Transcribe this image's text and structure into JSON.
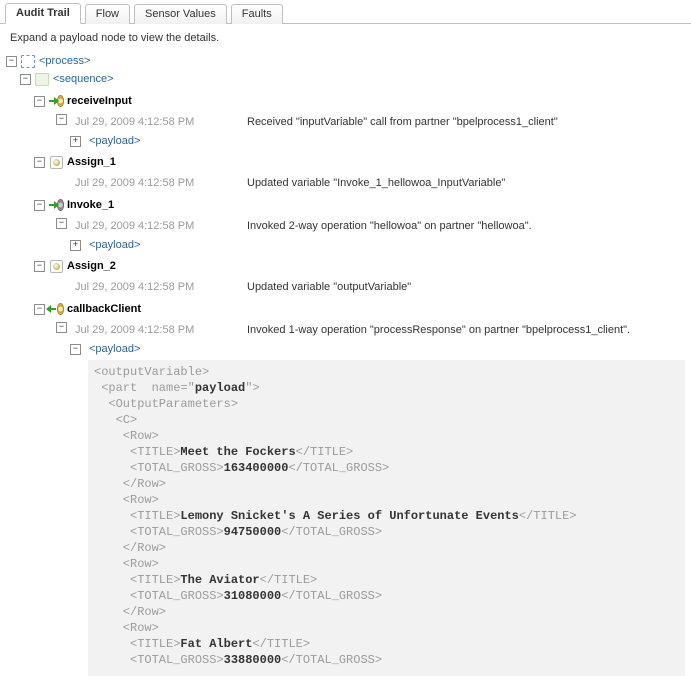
{
  "tabs": {
    "audit": "Audit Trail",
    "flow": "Flow",
    "sensor": "Sensor Values",
    "faults": "Faults"
  },
  "hint": "Expand a payload node to view the details.",
  "nodes": {
    "process": "<process>",
    "sequence": "<sequence>",
    "receiveInput": "receiveInput",
    "payload": "<payload>",
    "assign1": "Assign_1",
    "invoke1": "Invoke_1",
    "assign2": "Assign_2",
    "callbackClient": "callbackClient"
  },
  "events": {
    "e1": {
      "ts": "Jul 29, 2009 4:12:58 PM",
      "msg": "Received \"inputVariable\" call from partner \"bpelprocess1_client\""
    },
    "e2": {
      "ts": "Jul 29, 2009 4:12:58 PM",
      "msg": "Updated variable \"Invoke_1_hellowoa_InputVariable\""
    },
    "e3": {
      "ts": "Jul 29, 2009 4:12:58 PM",
      "msg": "Invoked 2-way operation \"hellowoa\" on partner \"hellowoa\"."
    },
    "e4": {
      "ts": "Jul 29, 2009 4:12:58 PM",
      "msg": "Updated variable \"outputVariable\""
    },
    "e5": {
      "ts": "Jul 29, 2009 4:12:58 PM",
      "msg": "Invoked 1-way operation \"processResponse\" on partner \"bpelprocess1_client\"."
    }
  },
  "xml": {
    "outputVariable_open": "<outputVariable>",
    "part_prefix": "<part  name=\"",
    "part_name": "payload",
    "part_suffix": "\">",
    "outputParams_open": "<OutputParameters>",
    "c_open": "<C>",
    "row_open": "<Row>",
    "title_open": "<TITLE>",
    "title_close": "</TITLE>",
    "gross_open": "<TOTAL_GROSS>",
    "gross_close": "</TOTAL_GROSS>",
    "row_close": "</Row>",
    "rows": [
      {
        "title": "Meet the Fockers",
        "gross": "163400000"
      },
      {
        "title": "Lemony Snicket's A Series of Unfortunate Events",
        "gross": "94750000"
      },
      {
        "title": "The Aviator",
        "gross": "31080000"
      },
      {
        "title": "Fat Albert",
        "gross": "33880000"
      }
    ]
  }
}
